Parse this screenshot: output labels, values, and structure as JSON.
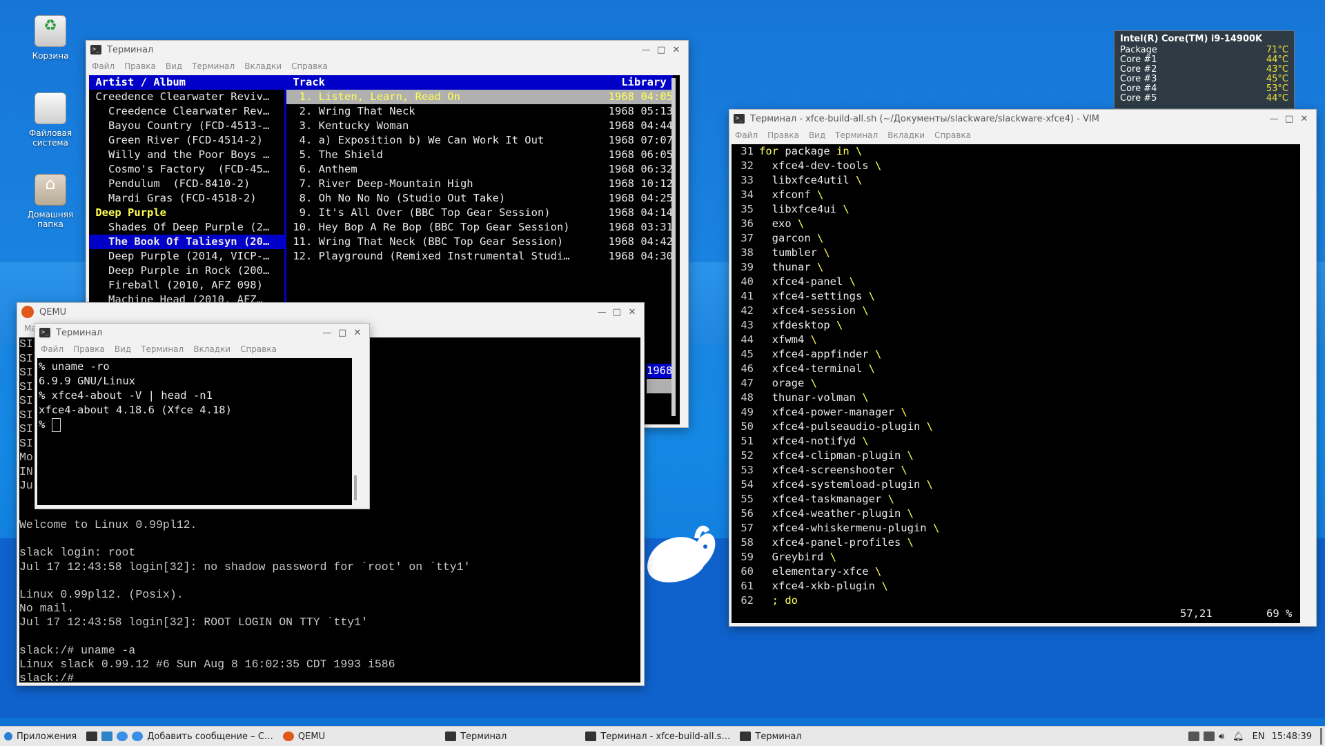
{
  "desktop": {
    "icons": [
      {
        "label": "Корзина"
      },
      {
        "label": "Файловая система"
      },
      {
        "label": "Домашняя папка"
      }
    ]
  },
  "sensors": {
    "title": "Intel(R) Core(TM) i9-14900K",
    "rows": [
      {
        "label": "Package",
        "value": "71°C"
      },
      {
        "label": "Core #1",
        "value": "44°C"
      },
      {
        "label": "Core #2",
        "value": "43°C"
      },
      {
        "label": "Core #3",
        "value": "45°C"
      },
      {
        "label": "Core #4",
        "value": "53°C"
      },
      {
        "label": "Core #5",
        "value": "44°C"
      }
    ]
  },
  "menu": [
    "Файл",
    "Правка",
    "Вид",
    "Терминал",
    "Вкладки",
    "Справка"
  ],
  "cmus": {
    "title": "Терминал",
    "header_left": " Artist / Album",
    "header_mid": " Track",
    "header_right": "Library ",
    "tree": [
      " Creedence Clearwater Reviv…",
      "   Creedence Clearwater Rev…",
      "   Bayou Country (FCD-4513-…",
      "   Green River (FCD-4514-2)",
      "   Willy and the Poor Boys …",
      "   Cosmo's Factory  (FCD-45…",
      "   Pendulum  (FCD-8410-2)",
      "   Mardi Gras (FCD-4518-2)",
      " Deep Purple",
      "   Shades Of Deep Purple (2…",
      "   The Book Of Taliesyn (20…",
      "   Deep Purple (2014, VICP-…",
      "   Deep Purple in Rock (200…",
      "   Fireball (2010, AFZ 098)",
      "   Machine Head (2010, AFZ…"
    ],
    "tracks": [
      {
        "t": "  1. Listen, Learn, Read On",
        "y": "1968 04:05"
      },
      {
        "t": "  2. Wring That Neck",
        "y": "1968 05:13"
      },
      {
        "t": "  3. Kentucky Woman",
        "y": "1968 04:44"
      },
      {
        "t": "  4. a) Exposition b) We Can Work It Out",
        "y": "1968 07:07"
      },
      {
        "t": "  5. The Shield",
        "y": "1968 06:05"
      },
      {
        "t": "  6. Anthem",
        "y": "1968 06:32"
      },
      {
        "t": "  7. River Deep-Mountain High",
        "y": "1968 10:12"
      },
      {
        "t": "  8. Oh No No No (Studio Out Take)",
        "y": "1968 04:25"
      },
      {
        "t": "  9. It's All Over (BBC Top Gear Session)",
        "y": "1968 04:14"
      },
      {
        "t": " 10. Hey Bop A Re Bop (BBC Top Gear Session)",
        "y": "1968 03:31"
      },
      {
        "t": " 11. Wring That Neck (BBC Top Gear Session)",
        "y": "1968 04:42"
      },
      {
        "t": " 12. Playground (Remixed Instrumental Studi…",
        "y": "1968 04:30"
      }
    ],
    "status_fragment": "1968"
  },
  "qemu": {
    "title": "QEMU",
    "menu_fragment": "Ma",
    "left_fragments": [
      "SI",
      "SI",
      "SI",
      "SI",
      "SI",
      "SI",
      "SI",
      "SI",
      "Mo",
      "IN",
      "Ju"
    ],
    "lines": [
      "Welcome to Linux 0.99pl12.",
      "",
      "slack login: root",
      "Jul 17 12:43:58 login[32]: no shadow password for `root' on `tty1'",
      "",
      "Linux 0.99pl12. (Posix).",
      "No mail.",
      "Jul 17 12:43:58 login[32]: ROOT LOGIN ON TTY `tty1'",
      "",
      "slack:/# uname -a",
      "Linux slack 0.99.12 #6 Sun Aug 8 16:02:35 CDT 1993 i586",
      "slack:/#"
    ]
  },
  "small_term": {
    "title": "Терминал",
    "lines": [
      "% uname -ro",
      "6.9.9 GNU/Linux",
      "% xfce4-about -V | head -n1",
      "xfce4-about 4.18.6 (Xfce 4.18)",
      "% "
    ]
  },
  "vim": {
    "title": "Терминал - xfce-build-all.sh (~/Документы/slackware/slackware-xfce4) - VIM",
    "lines": [
      {
        "n": "31",
        "kw1": "for",
        "mid": " package ",
        "kw2": "in",
        "rest": " \\"
      },
      {
        "n": "32",
        "text": "  xfce4-dev-tools \\"
      },
      {
        "n": "33",
        "text": "  libxfce4util \\"
      },
      {
        "n": "34",
        "text": "  xfconf \\"
      },
      {
        "n": "35",
        "text": "  libxfce4ui \\"
      },
      {
        "n": "36",
        "text": "  exo \\"
      },
      {
        "n": "37",
        "text": "  garcon \\"
      },
      {
        "n": "38",
        "text": "  tumbler \\"
      },
      {
        "n": "39",
        "text": "  thunar \\"
      },
      {
        "n": "40",
        "text": "  xfce4-panel \\"
      },
      {
        "n": "41",
        "text": "  xfce4-settings \\"
      },
      {
        "n": "42",
        "text": "  xfce4-session \\"
      },
      {
        "n": "43",
        "text": "  xfdesktop \\"
      },
      {
        "n": "44",
        "text": "  xfwm4 \\"
      },
      {
        "n": "45",
        "text": "  xfce4-appfinder \\"
      },
      {
        "n": "46",
        "text": "  xfce4-terminal \\"
      },
      {
        "n": "47",
        "text": "  orage \\"
      },
      {
        "n": "48",
        "text": "  thunar-volman \\"
      },
      {
        "n": "49",
        "text": "  xfce4-power-manager \\"
      },
      {
        "n": "50",
        "text": "  xfce4-pulseaudio-plugin \\"
      },
      {
        "n": "51",
        "text": "  xfce4-notifyd \\"
      },
      {
        "n": "52",
        "text": "  xfce4-clipman-plugin \\"
      },
      {
        "n": "53",
        "text": "  xfce4-screenshooter \\"
      },
      {
        "n": "54",
        "text": "  xfce4-systemload-plugin \\"
      },
      {
        "n": "55",
        "text": "  xfce4-taskmanager \\"
      },
      {
        "n": "56",
        "text": "  xfce4-weather-plugin \\"
      },
      {
        "n": "57",
        "text": "  xfce4-whiskermenu-plugin \\"
      },
      {
        "n": "58",
        "text": "  xfce4-panel-profiles \\"
      },
      {
        "n": "59",
        "text": "  Greybird \\"
      },
      {
        "n": "60",
        "text": "  elementary-xfce \\"
      },
      {
        "n": "61",
        "text": "  xfce4-xkb-plugin \\"
      },
      {
        "n": "62",
        "kw_text": "  ; do"
      }
    ],
    "position": "57,21",
    "percent": "69 %"
  },
  "taskbar": {
    "apps_label": "Приложения",
    "items": [
      "Добавить сообщение – С…",
      "QEMU",
      "Терминал",
      "Терминал - xfce-build-all.s…",
      "Терминал"
    ],
    "lang": "EN",
    "time": "15:48:39"
  }
}
